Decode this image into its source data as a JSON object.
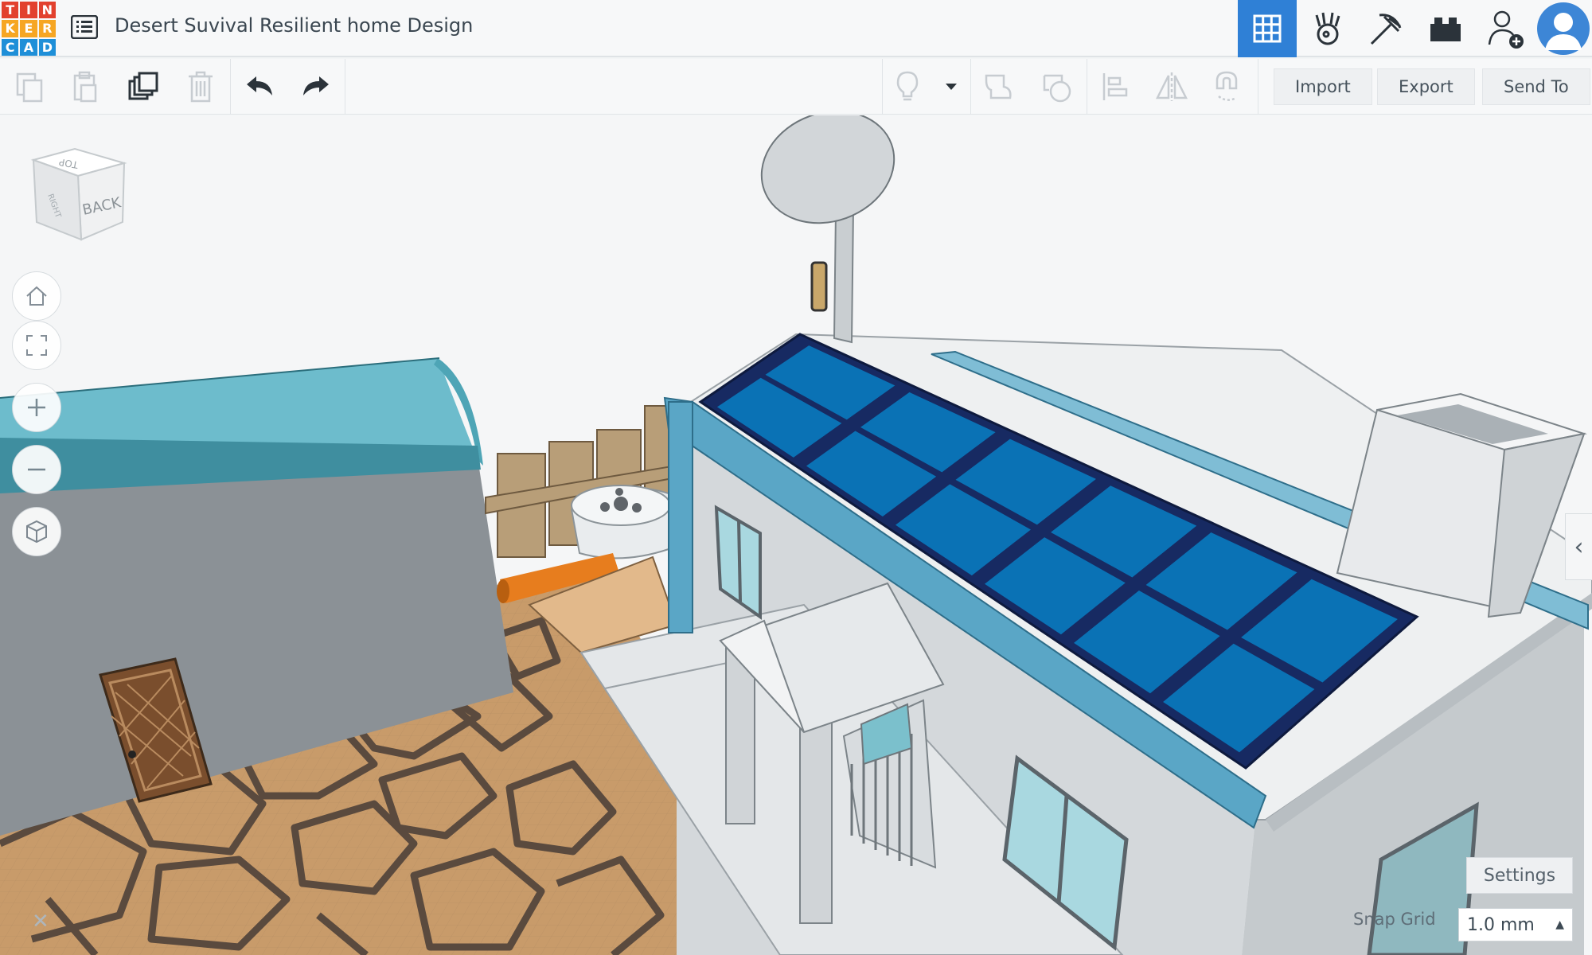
{
  "logo": {
    "letters": [
      "T",
      "I",
      "N",
      "K",
      "E",
      "R",
      "C",
      "A",
      "D"
    ],
    "colors": [
      "#e2412e",
      "#e2412e",
      "#e2412e",
      "#f6a623",
      "#f6a623",
      "#f6a623",
      "#1e8fd8",
      "#1e8fd8",
      "#1e8fd8"
    ]
  },
  "header": {
    "title": "Desert Suvival Resilient home Design",
    "icons": [
      "design-menu-icon",
      "3d-design-icon",
      "codeblocks-icon",
      "minecraft-pickaxe-icon",
      "lego-brick-icon",
      "add-collaborator-icon",
      "user-avatar-icon"
    ],
    "active_color": "#2f80d6"
  },
  "toolbar": {
    "icons": [
      "copy-icon",
      "paste-icon",
      "duplicate-icon",
      "delete-icon",
      "undo-icon",
      "redo-icon",
      "light-icon",
      "light-dropdown-icon",
      "group-icon",
      "ungroup-icon",
      "align-icon",
      "mirror-icon",
      "magnet-icon"
    ],
    "import_label": "Import",
    "export_label": "Export",
    "sendto_label": "Send To"
  },
  "viewcube": {
    "face_front": "BACK",
    "face_top": "TOP",
    "face_side": "RIGHT"
  },
  "view_controls": [
    "home-icon",
    "fit-view-icon",
    "zoom-in-icon",
    "zoom-out-icon",
    "ortho-icon"
  ],
  "settings": {
    "label": "Settings"
  },
  "snap_grid": {
    "label": "Snap Grid",
    "value": "1.0 mm"
  },
  "colors": {
    "solar": "#0a72b5",
    "solar_frame": "#172a62",
    "roof_green": "#6dbccc",
    "floor": "#c89b6a",
    "walls": "#d8dcdf"
  }
}
